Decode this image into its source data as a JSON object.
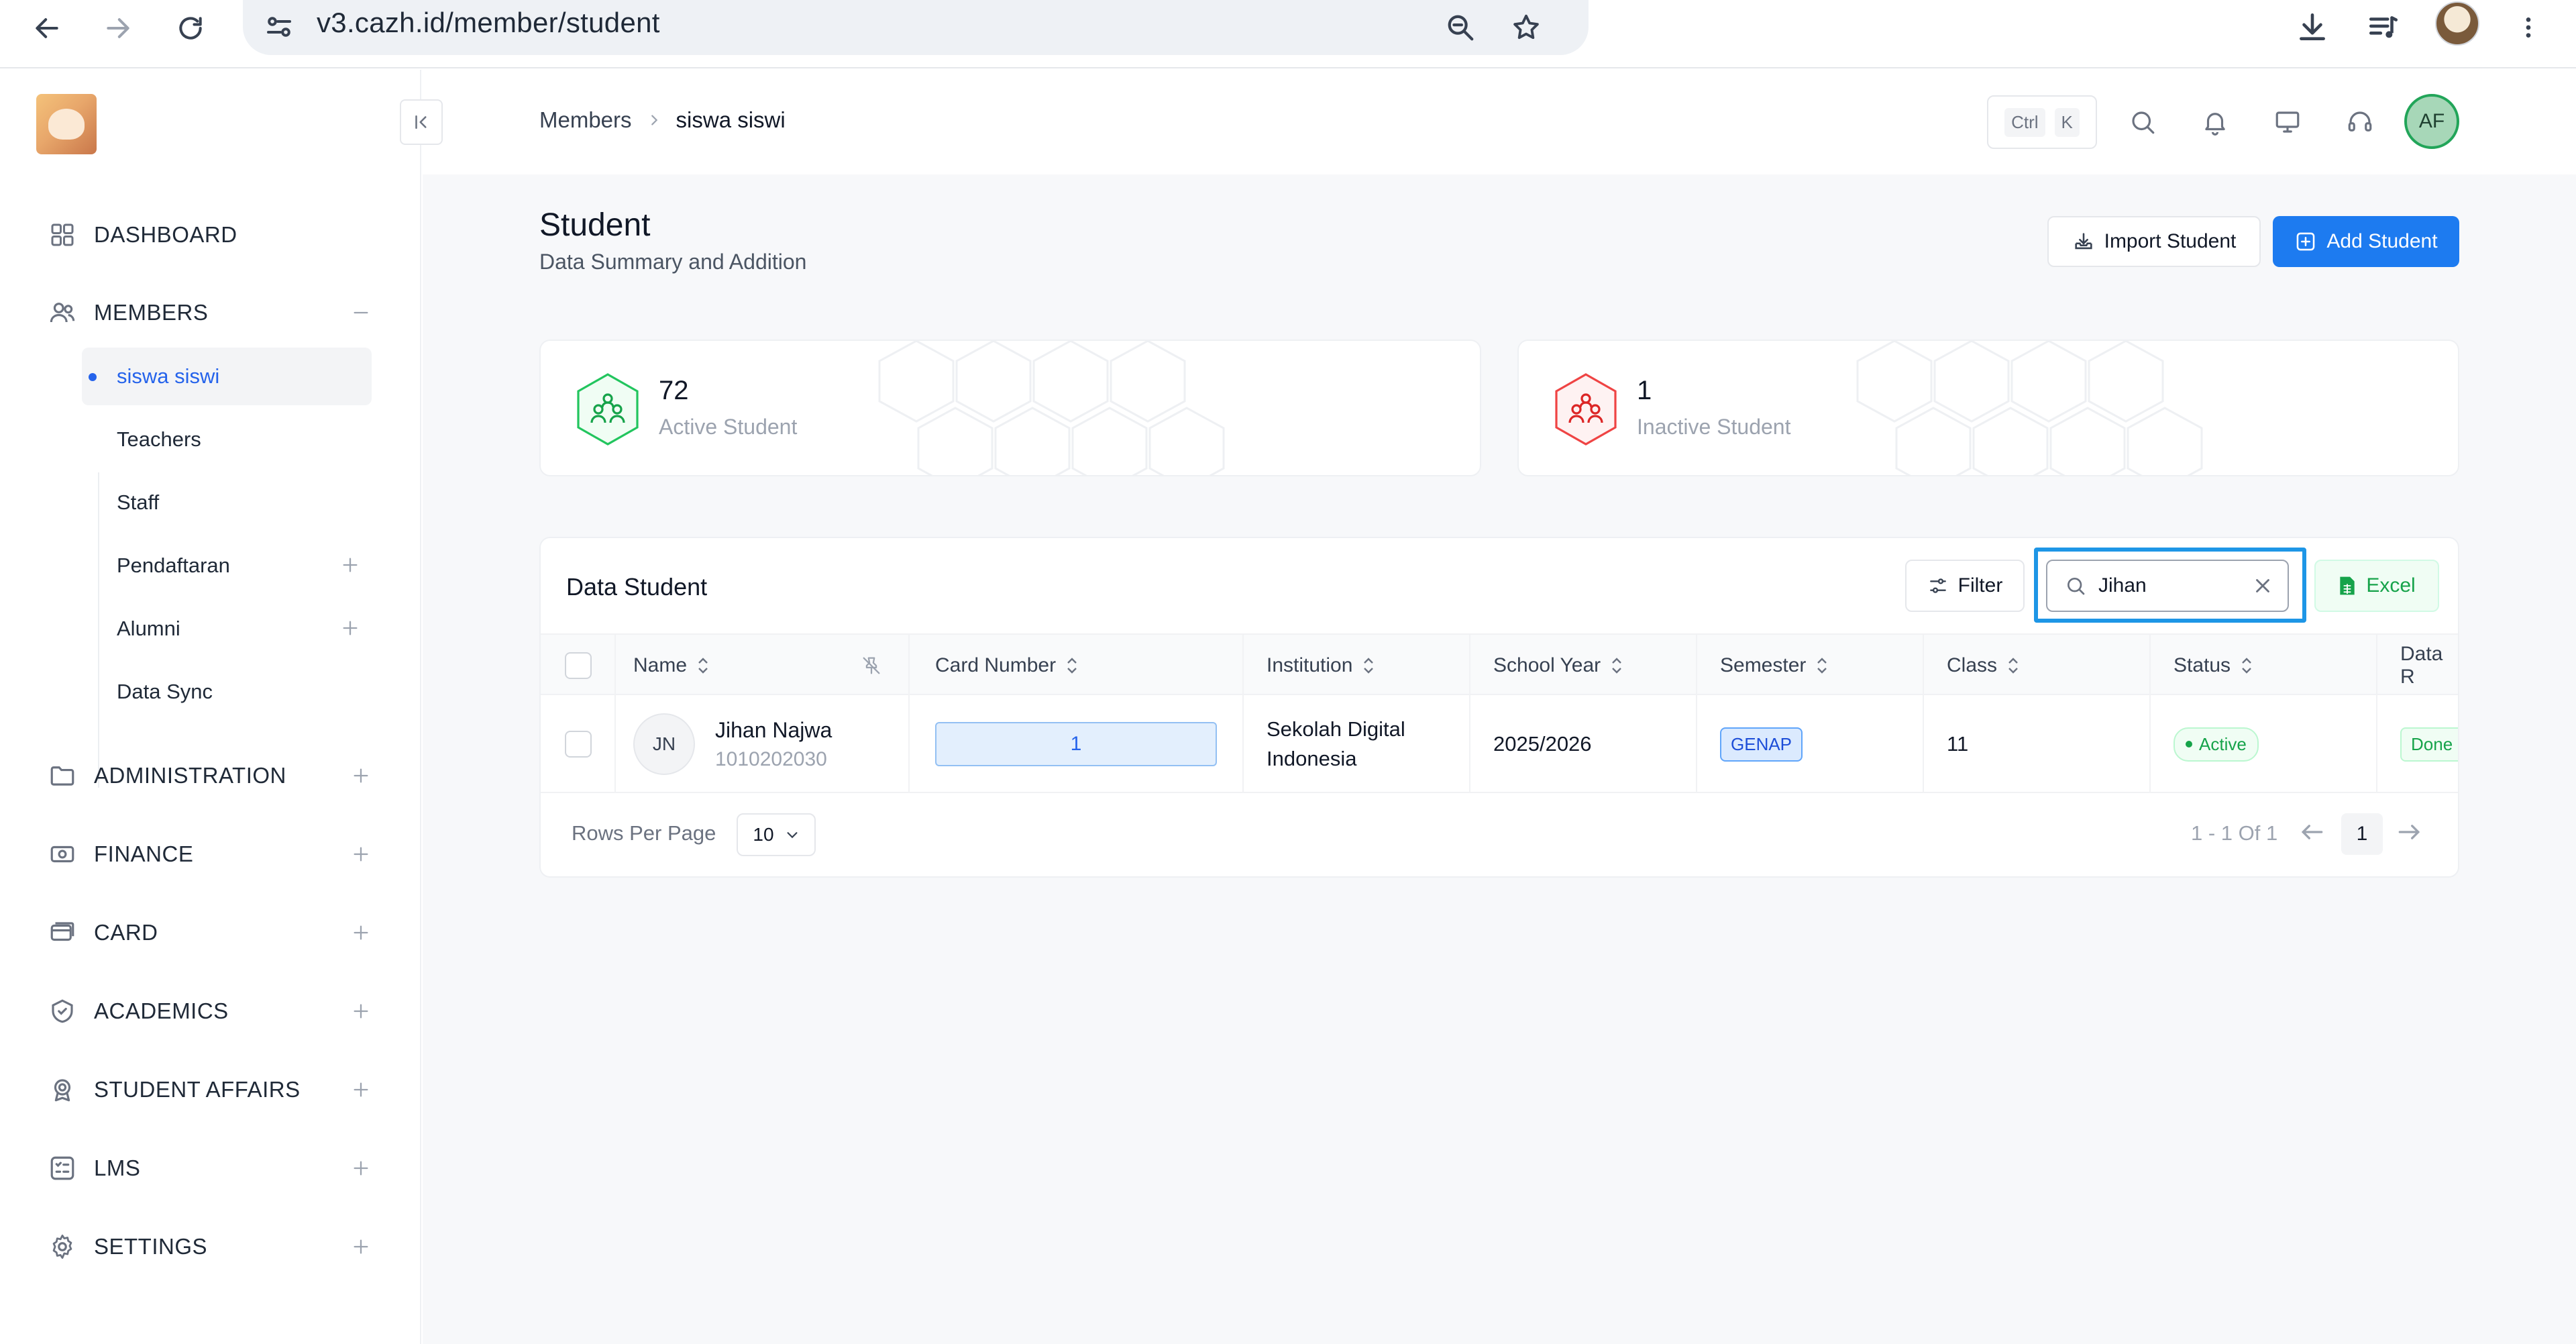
{
  "browser": {
    "url": "v3.cazh.id/member/student"
  },
  "sidebar": {
    "items": [
      {
        "label": "DASHBOARD",
        "icon": "grid-icon"
      },
      {
        "label": "MEMBERS",
        "icon": "users-icon",
        "toggle": "−"
      },
      {
        "label": "ADMINISTRATION",
        "icon": "folder-icon",
        "toggle": "+"
      },
      {
        "label": "FINANCE",
        "icon": "cash-icon",
        "toggle": "+"
      },
      {
        "label": "CARD",
        "icon": "card-icon",
        "toggle": "+"
      },
      {
        "label": "ACADEMICS",
        "icon": "academics-icon",
        "toggle": "+"
      },
      {
        "label": "STUDENT AFFAIRS",
        "icon": "badge-icon",
        "toggle": "+"
      },
      {
        "label": "LMS",
        "icon": "list-icon",
        "toggle": "+"
      },
      {
        "label": "SETTINGS",
        "icon": "gear-icon",
        "toggle": "+"
      }
    ],
    "members_sub": [
      {
        "label": "siswa siswi",
        "active": true
      },
      {
        "label": "Teachers"
      },
      {
        "label": "Staff"
      },
      {
        "label": "Pendaftaran",
        "toggle": "+"
      },
      {
        "label": "Alumni",
        "toggle": "+"
      },
      {
        "label": "Data Sync"
      }
    ]
  },
  "header": {
    "breadcrumb_parent": "Members",
    "breadcrumb_current": "siswa siswi",
    "kbd_ctrl": "Ctrl",
    "kbd_k": "K",
    "user_initials": "AF"
  },
  "page": {
    "title": "Student",
    "subtitle": "Data Summary and Addition",
    "import_label": "Import Student",
    "add_label": "Add Student"
  },
  "stats": {
    "active": {
      "value": "72",
      "label": "Active Student"
    },
    "inactive": {
      "value": "1",
      "label": "Inactive Student"
    }
  },
  "table": {
    "title": "Data Student",
    "filter_label": "Filter",
    "search_value": "Jihan",
    "excel_label": "Excel",
    "columns": [
      "Name",
      "Card Number",
      "Institution",
      "School Year",
      "Semester",
      "Class",
      "Status",
      "Data R"
    ],
    "rows": [
      {
        "initials": "JN",
        "name": "Jihan Najwa",
        "id": "1010202030",
        "card_number": "1",
        "institution_line1": "Sekolah Digital",
        "institution_line2": "Indonesia",
        "school_year": "2025/2026",
        "semester": "GENAP",
        "class": "11",
        "status": "Active",
        "data_r": "Done"
      }
    ],
    "rows_per_page_label": "Rows Per Page",
    "rows_per_page": "10",
    "page_info": "1 - 1 Of 1",
    "current_page": "1"
  },
  "colors": {
    "primary": "#1d7bf0",
    "success": "#16a34a",
    "danger": "#ef4444",
    "highlight": "#1e96e6"
  }
}
